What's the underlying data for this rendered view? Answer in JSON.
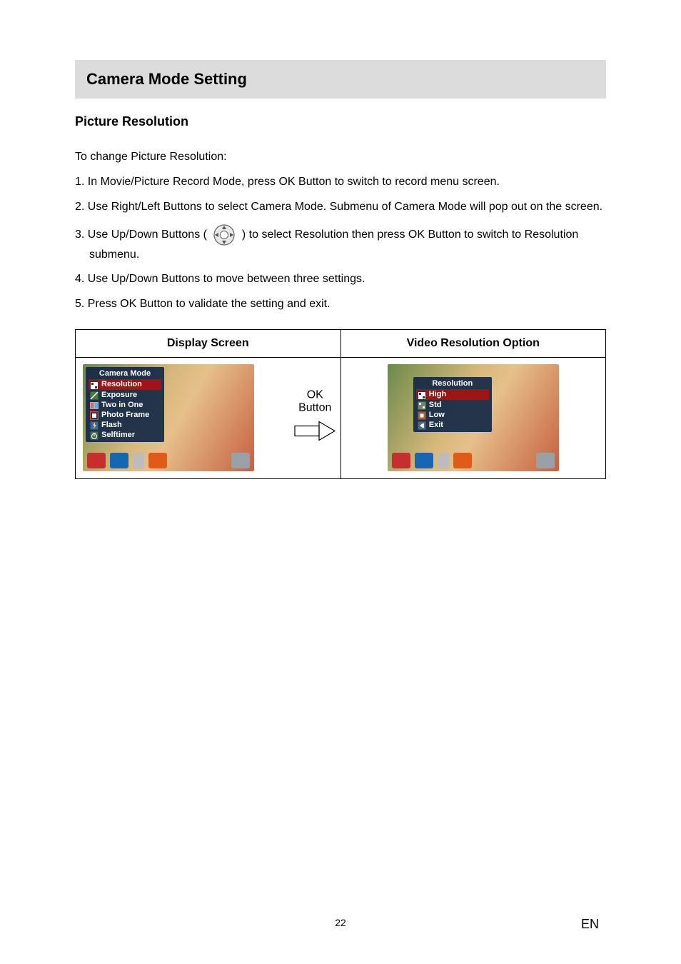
{
  "section_title": "Camera Mode Setting",
  "subsection_title": "Picture Resolution",
  "intro": "To change Picture Resolution:",
  "steps": [
    {
      "n": "1.",
      "text": "In Movie/Picture Record Mode, press OK Button to switch to record menu screen."
    },
    {
      "n": "2.",
      "text": "Use Right/Left Buttons to select Camera Mode. Submenu of Camera Mode will pop out on the screen."
    },
    {
      "n": "3.",
      "pre": "Use Up/Down Buttons (",
      "post": ") to select Resolution then press OK Button to switch to Resolution submenu."
    },
    {
      "n": "4.",
      "text": "Use Up/Down Buttons to move between three settings."
    },
    {
      "n": "5.",
      "text": "Press OK Button to validate the setting and exit."
    }
  ],
  "table": {
    "header_left": "Display Screen",
    "header_right": "Video Resolution Option",
    "ok_label": "OK Button",
    "left_menu": {
      "title": "Camera Mode",
      "items": [
        "Resolution",
        "Exposure",
        "Two in One",
        "Photo Frame",
        "Flash",
        "Selftimer"
      ],
      "selected_index": 0
    },
    "right_menu": {
      "title": "Resolution",
      "items": [
        "High",
        "Std",
        "Low",
        "Exit"
      ],
      "selected_index": 0
    }
  },
  "page_number": "22",
  "lang": "EN"
}
